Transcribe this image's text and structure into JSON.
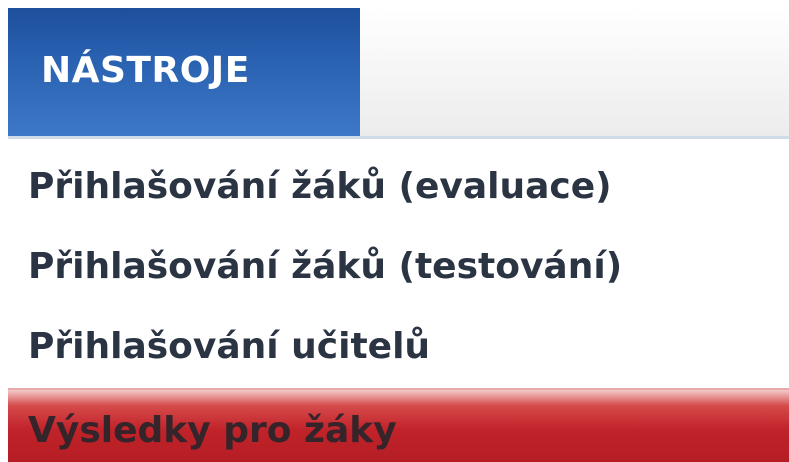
{
  "menu": {
    "title": "NÁSTROJE",
    "items": [
      {
        "label": "Přihlašování žáků (evaluace)"
      },
      {
        "label": "Přihlašování žáků (testování)"
      },
      {
        "label": "Přihlašování učitelů"
      },
      {
        "label": "Výsledky pro žáky",
        "state": "hover"
      }
    ]
  },
  "colors": {
    "header_tab": "#2b63b3",
    "header_text": "#ffffff",
    "item_text": "#2a3442",
    "hover_background": "#c1232a"
  }
}
